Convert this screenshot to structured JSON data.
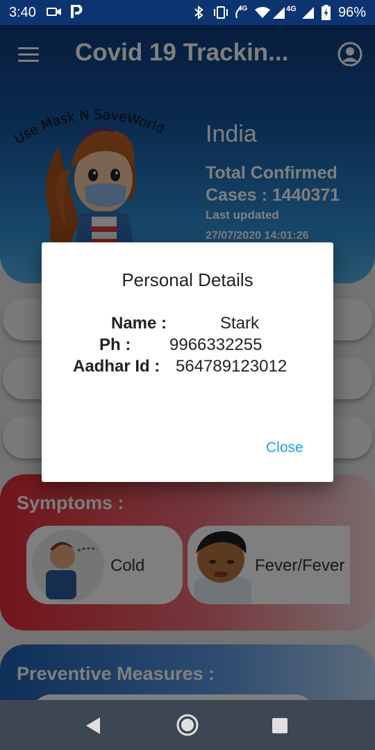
{
  "status_bar": {
    "time": "3:40",
    "battery_percent": "96%",
    "network_label_1": "4G",
    "network_label_2": "4G",
    "icons": [
      "video-icon",
      "parking-icon",
      "bluetooth-icon",
      "vibrate-icon",
      "volte-icon",
      "wifi-icon",
      "signal-icon",
      "signal-icon",
      "battery-charging-icon"
    ]
  },
  "header": {
    "title": "Covid 19 Trackin...",
    "mascot_text": "Use Mask N SaveWorld",
    "country": "India",
    "total_label": "Total Confirmed Cases : 1440371",
    "updated_label": "Last updated",
    "updated_time": "27/07/2020 14:01:26"
  },
  "symptoms": {
    "title": "Symptoms :",
    "items": [
      {
        "label": "Cold"
      },
      {
        "label": "Fever/Fever"
      }
    ]
  },
  "preventive": {
    "title": "Preventive Measures :"
  },
  "dialog": {
    "title": "Personal Details",
    "fields": [
      {
        "label": "Name :",
        "value": "Stark"
      },
      {
        "label": "Ph :",
        "value": "9966332255"
      },
      {
        "label": "Aadhar Id :",
        "value": "564789123012"
      }
    ],
    "close_label": "Close"
  },
  "colors": {
    "header_top": "#0e3a7c",
    "header_bottom": "#56b0e6",
    "symptoms_red": "#e32a36",
    "accent_link": "#1da1f2",
    "nav_bar": "#3d4753"
  }
}
